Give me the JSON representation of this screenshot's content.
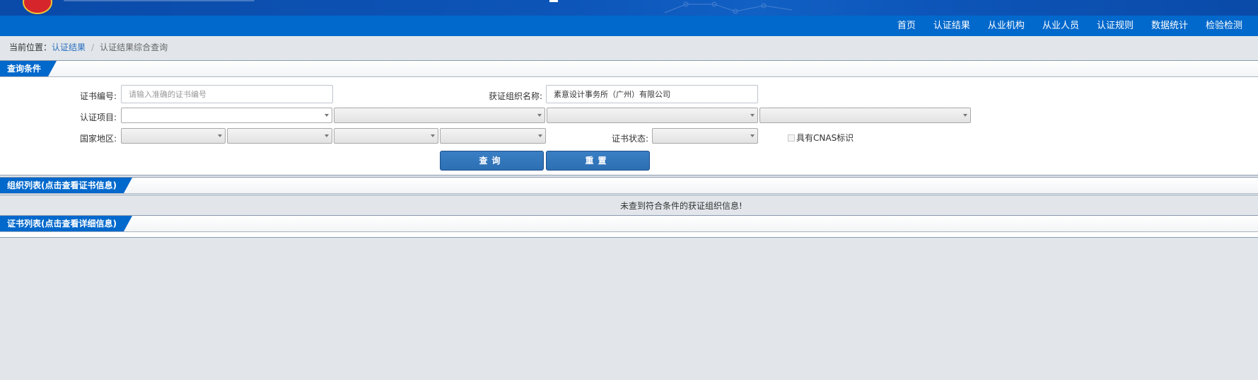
{
  "nav": [
    "首页",
    "认证结果",
    "从业机构",
    "从业人员",
    "认证规则",
    "数据统计",
    "检验检测"
  ],
  "breadcrumb": {
    "prefix": "当前位置：",
    "link": "认证结果",
    "separator": "/",
    "current": "认证结果综合查询"
  },
  "query_panel": {
    "title": "查询条件",
    "cert_no_label": "证书编号:",
    "cert_no_placeholder": "请输入准确的证书编号",
    "org_name_label": "获证组织名称:",
    "org_name_value": "素意设计事务所（广州）有限公司",
    "project_label": "认证项目:",
    "region_label": "国家地区:",
    "status_label": "证书状态:",
    "cnas_label": "具有CNAS标识",
    "search_button": "查询",
    "reset_button": "重置"
  },
  "org_panel": {
    "title": "组织列表(点击查看证书信息)",
    "empty_message": "未查到符合条件的获证组织信息!"
  },
  "cert_panel": {
    "title": "证书列表(点击查看详细信息)"
  },
  "colors": {
    "nav_bg": "#0168cc",
    "banner_bg": "#0d55b8",
    "button_bg": "#2d6fb3",
    "page_bg": "#e2e6ea"
  }
}
